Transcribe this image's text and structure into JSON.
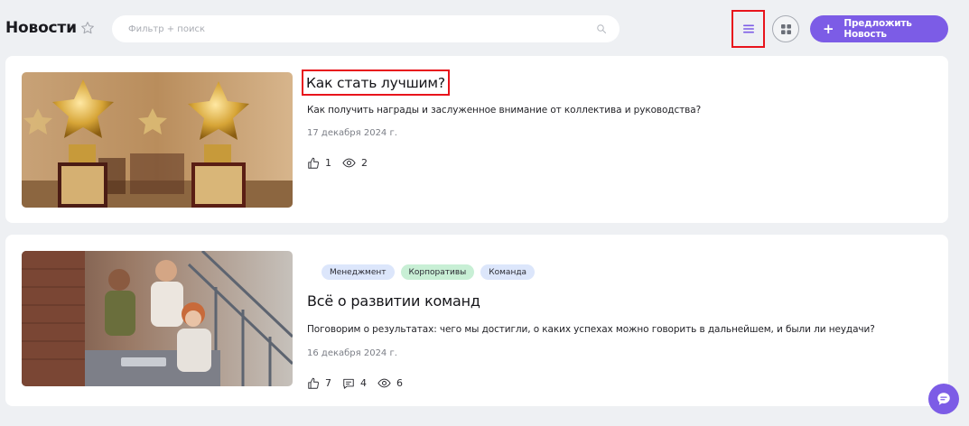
{
  "header": {
    "title": "Новости",
    "search_placeholder": "Фильтр + поиск",
    "propose_label": "Предложить Новость"
  },
  "news": [
    {
      "title": "Как стать лучшим?",
      "description": "Как получить награды и заслуженное внимание от коллектива и руководства?",
      "date": "17 декабря 2024 г.",
      "likes": "1",
      "views": "2",
      "tags": []
    },
    {
      "title": "Всё о развитии команд",
      "description": "Поговорим о результатах: чего мы достигли, о каких успехах можно говорить в дальнейшем, и были ли неудачи?",
      "date": "16 декабря 2024 г.",
      "likes": "7",
      "comments": "4",
      "views": "6",
      "tags": [
        "Менеджмент",
        "Корпоративы",
        "Команда"
      ]
    }
  ],
  "colors": {
    "accent": "#7c5ce6",
    "highlight": "#e8141c",
    "tag_blue": "#dce6fb",
    "tag_green": "#c8efd5"
  },
  "icons": [
    "star-icon",
    "search-icon",
    "list-view-icon",
    "grid-view-icon",
    "plus-icon",
    "like-icon",
    "eye-icon",
    "comment-icon",
    "chat-icon"
  ]
}
